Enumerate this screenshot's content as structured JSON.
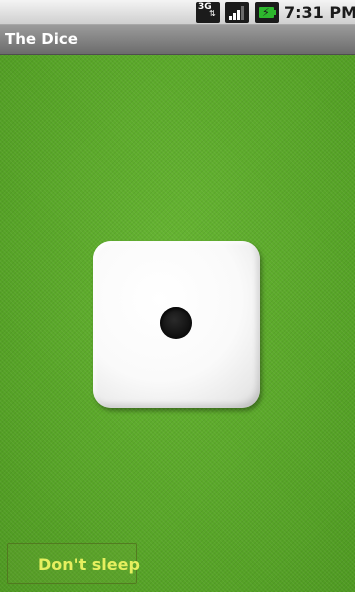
{
  "status_bar": {
    "network_label": "3G",
    "network_icon": "3g-data-icon",
    "signal_icon": "signal-strength-icon",
    "battery_icon": "battery-charging-icon",
    "time": "7:31 PM"
  },
  "title_bar": {
    "title": "The Dice"
  },
  "dice": {
    "face_value": 1,
    "pip_icon": "die-pip"
  },
  "controls": {
    "dont_sleep_label": "Don't sleep",
    "dont_sleep_checked": false
  },
  "colors": {
    "felt": "#5dab2c",
    "title_bar": "#7f7f7f",
    "dont_sleep_text": "#e6ef5f"
  }
}
